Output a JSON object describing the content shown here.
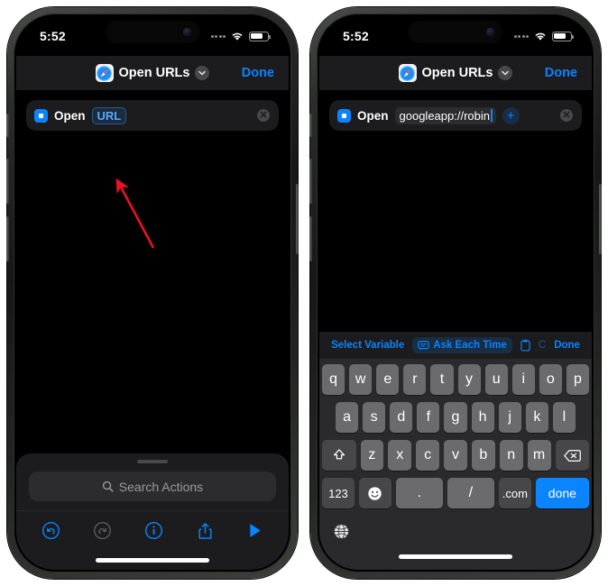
{
  "phones": [
    {
      "id": "left",
      "status": {
        "time": "5:52",
        "cellular_icon": "cellular-dots-icon",
        "wifi_icon": "wifi-icon",
        "battery_icon": "battery-icon"
      },
      "navbar": {
        "app_icon": "safari-compass-icon",
        "title": "Open URLs",
        "chevron_icon": "chevron-down-icon",
        "done_label": "Done"
      },
      "action": {
        "icon": "open-urls-action-icon",
        "verb": "Open",
        "parameter_kind": "placeholder",
        "parameter": "URL",
        "close_icon": "close-circle-icon"
      },
      "annotation": {
        "type": "red-arrow",
        "color": "#ee1122",
        "points_to": "URL placeholder token"
      },
      "bottom_sheet": {
        "search_placeholder": "Search Actions",
        "search_icon": "search-icon",
        "tools": [
          {
            "name": "undo-button",
            "icon": "undo-icon",
            "color": "#0a84ff"
          },
          {
            "name": "redo-button",
            "icon": "redo-icon",
            "color": "#5a5a5e"
          },
          {
            "name": "info-button",
            "icon": "info-circle-icon",
            "color": "#0a84ff"
          },
          {
            "name": "share-button",
            "icon": "share-icon",
            "color": "#0a84ff"
          },
          {
            "name": "run-button",
            "icon": "play-triangle-icon",
            "color": "#0a84ff"
          }
        ]
      }
    },
    {
      "id": "right",
      "status": {
        "time": "5:52",
        "cellular_icon": "cellular-dots-icon",
        "wifi_icon": "wifi-icon",
        "battery_icon": "battery-icon"
      },
      "navbar": {
        "app_icon": "safari-compass-icon",
        "title": "Open URLs",
        "chevron_icon": "chevron-down-icon",
        "done_label": "Done"
      },
      "action": {
        "icon": "open-urls-action-icon",
        "verb": "Open",
        "parameter_kind": "value",
        "parameter": "googleapp://robin",
        "add_variable_label": "+",
        "close_icon": "close-circle-icon"
      },
      "keyboard": {
        "accessory": {
          "select_variable_label": "Select Variable",
          "ask_each_time_label": "Ask Each Time",
          "ask_each_time_icon": "speech-bubble-icon",
          "clipboard_icon": "clipboard-icon",
          "partial_label": "C",
          "done_label": "Done"
        },
        "rows": [
          [
            "q",
            "w",
            "e",
            "r",
            "t",
            "y",
            "u",
            "i",
            "o",
            "p"
          ],
          [
            "a",
            "s",
            "d",
            "f",
            "g",
            "h",
            "j",
            "k",
            "l"
          ]
        ],
        "row3": {
          "shift_icon": "shift-arrow-icon",
          "keys": [
            "z",
            "x",
            "c",
            "v",
            "b",
            "n",
            "m"
          ],
          "backspace_icon": "backspace-icon"
        },
        "row4": {
          "numbers_label": "123",
          "emoji_icon": "emoji-smiley-icon",
          "period_label": ".",
          "slash_label": "/",
          "dotcom_label": ".com",
          "done_label": "done"
        },
        "globe_icon": "globe-icon"
      }
    }
  ],
  "colors": {
    "accent_blue": "#0a84ff",
    "annotation_red": "#ee1122",
    "panel": "#1c1c1e",
    "key": "#6b6b6e"
  }
}
